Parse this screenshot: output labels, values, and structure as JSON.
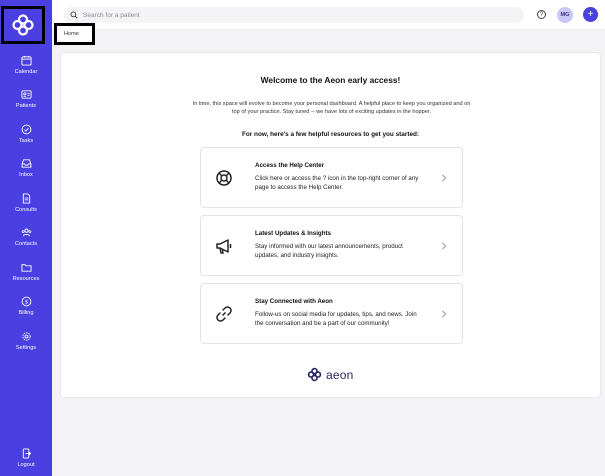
{
  "sidebar": {
    "items": [
      {
        "label": "Calendar",
        "icon": "calendar-icon"
      },
      {
        "label": "Patients",
        "icon": "id-card-icon"
      },
      {
        "label": "Tasks",
        "icon": "check-circle-icon"
      },
      {
        "label": "Inbox",
        "icon": "inbox-icon"
      },
      {
        "label": "Consults",
        "icon": "document-icon"
      },
      {
        "label": "Contacts",
        "icon": "contacts-icon"
      },
      {
        "label": "Resources",
        "icon": "folder-icon"
      },
      {
        "label": "Billing",
        "icon": "dollar-icon"
      },
      {
        "label": "Settings",
        "icon": "gear-icon"
      }
    ],
    "logout_label": "Logout"
  },
  "topbar": {
    "search_placeholder": "Search for a patient",
    "help_label": "?",
    "avatar_initials": "MG",
    "add_label": "+"
  },
  "breadcrumb": {
    "label": "Home"
  },
  "main": {
    "welcome_title": "Welcome to the Aeon early access!",
    "intro_text": "In time, this space will evolve to become your personal dashboard. A helpful place to keep you organized and on top of your practice. Stay tuned -- we have lots of exciting updates in the hopper.",
    "resources_heading": "For now, here's a few helpful resources to get you started:",
    "cards": [
      {
        "title": "Access the Help Center",
        "description": "Click here or access the ? icon in the top-right corner of any page to access the Help Center.",
        "icon": "lifebuoy-icon"
      },
      {
        "title": "Latest Updates & Insights",
        "description": "Stay informed with our latest announcements, product updates, and industry insights.",
        "icon": "megaphone-icon"
      },
      {
        "title": "Stay Connected with Aeon",
        "description": "Follow-us on social media for updates, tips, and news. Join the conversation and be a part of our community!",
        "icon": "link-icon"
      }
    ],
    "brand_word": "aeon"
  },
  "colors": {
    "sidebar": "#4a3fe0",
    "accent": "#4a3fe0",
    "brand_text": "#2a2666"
  }
}
